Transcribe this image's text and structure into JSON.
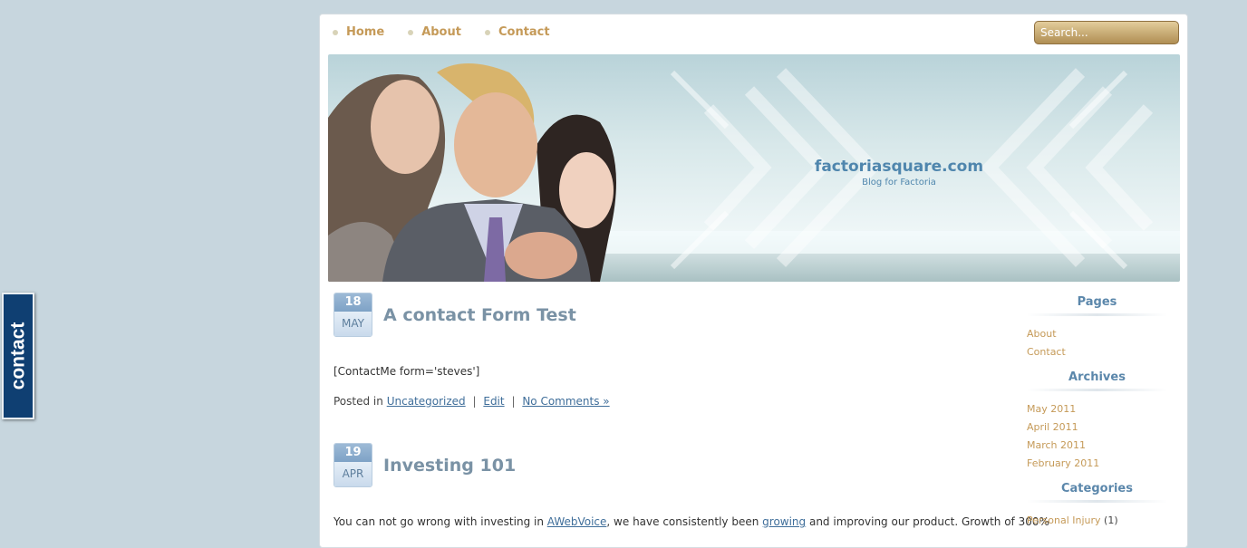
{
  "contact_tab": {
    "label": "contact"
  },
  "nav": {
    "items": [
      {
        "label": "Home"
      },
      {
        "label": "About"
      },
      {
        "label": "Contact"
      }
    ]
  },
  "search": {
    "placeholder": "Search..."
  },
  "header": {
    "title": "factoriasquare.com",
    "tagline": "Blog for Factoria"
  },
  "posts": [
    {
      "day": "18",
      "month": "MAY",
      "title": "A contact Form Test",
      "body": "[ContactMe form='steves']",
      "meta": {
        "posted_in": "Posted in",
        "category": "Uncategorized",
        "edit": "Edit",
        "comments": "No Comments »"
      }
    },
    {
      "day": "19",
      "month": "APR",
      "title": "Investing 101",
      "body_parts": {
        "p1": "You can not go wrong with investing in ",
        "link1": "AWebVoice",
        "p2": ", we have consistently been ",
        "link2": "growing",
        "p3": " and improving our product. Growth of 300%"
      }
    }
  ],
  "sidebar": {
    "pages": {
      "title": "Pages",
      "items": [
        "About",
        "Contact"
      ]
    },
    "archives": {
      "title": "Archives",
      "items": [
        "May 2011",
        "April 2011",
        "March 2011",
        "February 2011"
      ]
    },
    "categories": {
      "title": "Categories",
      "first_item": "Personal Injury",
      "first_count": "(1)"
    }
  },
  "colors": {
    "background": "#c7d6de",
    "nav_link": "#c59a58",
    "title_blue": "#4f86ad",
    "contact_tab": "#0f3f72"
  }
}
